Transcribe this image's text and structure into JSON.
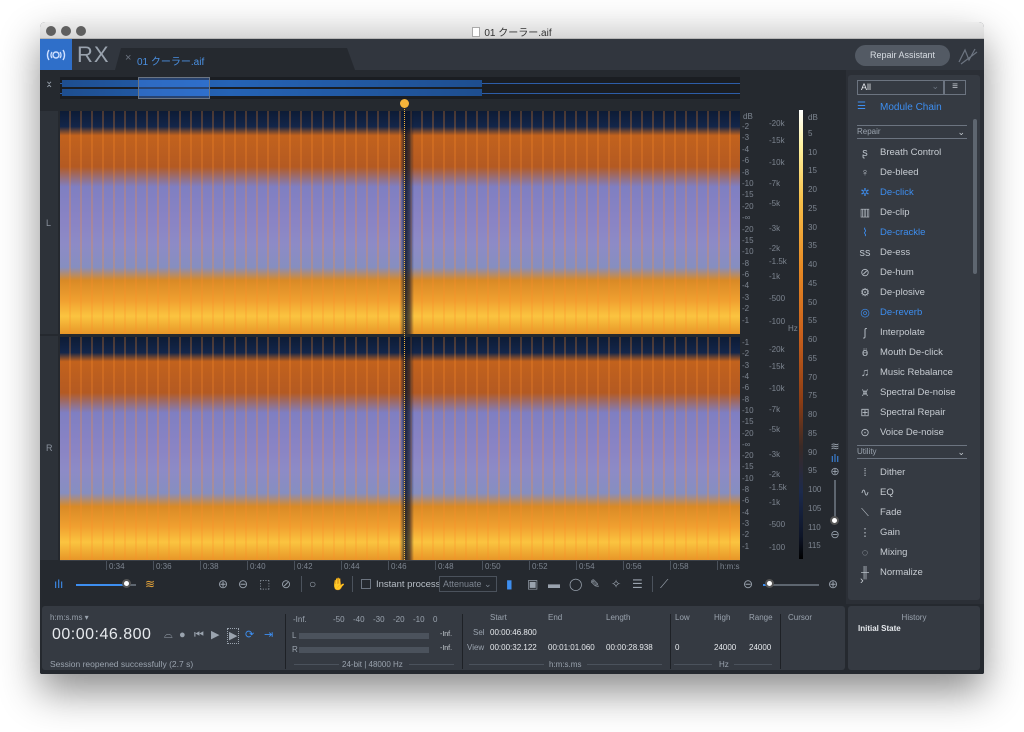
{
  "window": {
    "title": "01 クーラー.aif",
    "app_name": "RX",
    "tab_name": "01 クーラー.aif",
    "repair_assistant_label": "Repair Assistant"
  },
  "spectrogram": {
    "channels": [
      "L",
      "R"
    ],
    "db_scale_label": "dB",
    "db_ticks": [
      "-2",
      "-3",
      "-4",
      "-6",
      "-8",
      "-10",
      "-15",
      "-20",
      "-∞",
      "-20",
      "-15",
      "-10",
      "-8",
      "-6",
      "-4",
      "-3",
      "-2",
      "-1"
    ],
    "db_ticks_r": [
      "-1",
      "-2",
      "-3",
      "-4",
      "-6",
      "-8",
      "-10",
      "-15",
      "-20",
      "-∞",
      "-20",
      "-15",
      "-10",
      "-8",
      "-6",
      "-4",
      "-3",
      "-2",
      "-1"
    ],
    "hz_ticks": [
      "-20k",
      "-15k",
      "-10k",
      "-7k",
      "-5k",
      "-3k",
      "-2k",
      "-1.5k",
      "-1k",
      "-500",
      "-100"
    ],
    "hz_unit": "Hz",
    "colorbar_label": "dB",
    "colorbar_ticks": [
      "5",
      "10",
      "15",
      "20",
      "25",
      "30",
      "35",
      "40",
      "45",
      "50",
      "55",
      "60",
      "65",
      "70",
      "75",
      "80",
      "85",
      "90",
      "95",
      "100",
      "105",
      "110",
      "115"
    ],
    "time_ticks": [
      "0:34",
      "0:36",
      "0:38",
      "0:40",
      "0:42",
      "0:44",
      "0:46",
      "0:48",
      "0:50",
      "0:52",
      "0:54",
      "0:56",
      "0:58"
    ],
    "time_unit": "h:m:s",
    "colors": {
      "low_energy": "#8a86c4",
      "high_energy": "#f0a030",
      "peak": "#fbc440",
      "background": "#0d1b35",
      "playhead": "#f5b43a"
    }
  },
  "toolbar": {
    "instant_process_label": "Instant process",
    "instant_process_checked": false,
    "mode_value": "Attenuate",
    "waveform_blend": 0.85,
    "zoom_level": 0.12
  },
  "modules": {
    "filter_value": "All",
    "module_chain_label": "Module Chain",
    "repair_section": "Repair",
    "repair": [
      {
        "label": "Breath Control",
        "icon": "breath-icon",
        "active": false
      },
      {
        "label": "De-bleed",
        "icon": "mic-icon",
        "active": false
      },
      {
        "label": "De-click",
        "icon": "click-icon",
        "active": true
      },
      {
        "label": "De-clip",
        "icon": "clip-icon",
        "active": false
      },
      {
        "label": "De-crackle",
        "icon": "crackle-icon",
        "active": true
      },
      {
        "label": "De-ess",
        "icon": "ess-icon",
        "active": false
      },
      {
        "label": "De-hum",
        "icon": "hum-icon",
        "active": false
      },
      {
        "label": "De-plosive",
        "icon": "plosive-icon",
        "active": false
      },
      {
        "label": "De-reverb",
        "icon": "reverb-icon",
        "active": true
      },
      {
        "label": "Interpolate",
        "icon": "interpolate-icon",
        "active": false
      },
      {
        "label": "Mouth De-click",
        "icon": "mouth-icon",
        "active": false
      },
      {
        "label": "Music Rebalance",
        "icon": "music-icon",
        "active": false
      },
      {
        "label": "Spectral De-noise",
        "icon": "spectral-denoise-icon",
        "active": false
      },
      {
        "label": "Spectral Repair",
        "icon": "spectral-repair-icon",
        "active": false
      },
      {
        "label": "Voice De-noise",
        "icon": "voice-icon",
        "active": false
      }
    ],
    "utility_section": "Utility",
    "utility": [
      {
        "label": "Dither",
        "icon": "dither-icon"
      },
      {
        "label": "EQ",
        "icon": "eq-icon"
      },
      {
        "label": "Fade",
        "icon": "fade-icon"
      },
      {
        "label": "Gain",
        "icon": "gain-icon"
      },
      {
        "label": "Mixing",
        "icon": "mixing-icon"
      },
      {
        "label": "Normalize",
        "icon": "normalize-icon"
      }
    ]
  },
  "transport": {
    "time_format": "h:m:s.ms",
    "current_time": "00:00:46.800",
    "status": "Session reopened successfully (2.7 s)"
  },
  "meters": {
    "scale": [
      "-Inf.",
      "-50",
      "-40",
      "-30",
      "-20",
      "-10",
      "0"
    ],
    "left_label": "L",
    "right_label": "R",
    "left_value": "-Inf.",
    "right_value": "-Inf.",
    "format": "24-bit | 48000 Hz"
  },
  "selection": {
    "headers": [
      "Start",
      "End",
      "Length"
    ],
    "sel_label": "Sel",
    "view_label": "View",
    "sel_start": "00:00:46.800",
    "view_start": "00:00:32.122",
    "view_end": "00:01:01.060",
    "view_length": "00:00:28.938",
    "unit": "h:m:s.ms"
  },
  "frequency": {
    "headers": [
      "Low",
      "High",
      "Range"
    ],
    "low": "0",
    "high": "24000",
    "range": "24000",
    "unit": "Hz",
    "cursor_label": "Cursor"
  },
  "history": {
    "title": "History",
    "items": [
      "Initial State"
    ]
  }
}
